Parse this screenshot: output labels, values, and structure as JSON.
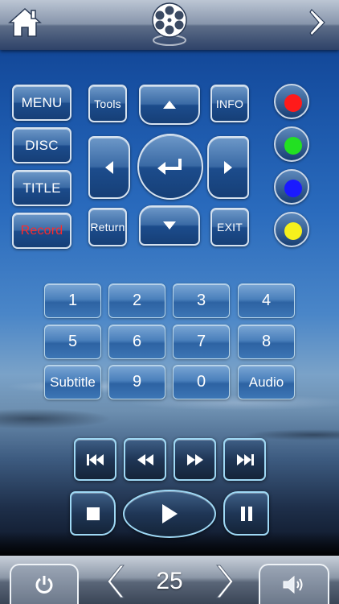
{
  "header": {
    "home_icon": "home-icon",
    "logo_icon": "film-reel-icon",
    "next_icon": "chevron-right-icon"
  },
  "menu_buttons": {
    "menu": "MENU",
    "disc": "DISC",
    "title": "TITLE",
    "record": "Record",
    "tools": "Tools",
    "info": "INFO",
    "return": "Return",
    "exit": "EXIT"
  },
  "color_keys": [
    {
      "name": "red",
      "color": "#ff1a1a"
    },
    {
      "name": "green",
      "color": "#22e022"
    },
    {
      "name": "blue",
      "color": "#1a1aff"
    },
    {
      "name": "yellow",
      "color": "#f6f01c"
    }
  ],
  "keypad": {
    "k1": "1",
    "k2": "2",
    "k3": "3",
    "k4": "4",
    "k5": "5",
    "k6": "6",
    "k7": "7",
    "k8": "8",
    "subtitle": "Subtitle",
    "k9": "9",
    "k0": "0",
    "audio": "Audio"
  },
  "transport_icons": [
    "skip-previous-icon",
    "rewind-icon",
    "fast-forward-icon",
    "skip-next-icon",
    "stop-icon",
    "play-icon",
    "pause-icon"
  ],
  "footer": {
    "channel": "25",
    "power_icon": "power-icon",
    "volume_icon": "volume-icon"
  },
  "colors": {
    "record_text": "#ff2a2a",
    "button_border": "#d6e2ef",
    "transport_border": "#9fd9f5"
  }
}
